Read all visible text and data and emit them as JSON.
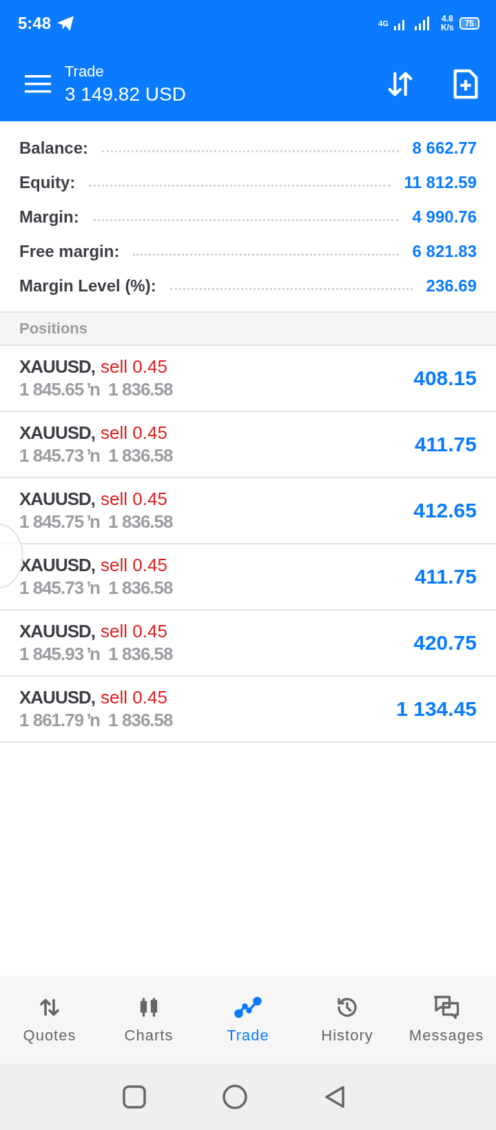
{
  "status_bar": {
    "time": "5:48",
    "network": "4G",
    "speed_value": "4.8",
    "speed_unit": "K/s",
    "battery": "75"
  },
  "header": {
    "title": "Trade",
    "subtitle": "3 149.82 USD"
  },
  "summary": [
    {
      "label": "Balance:",
      "value": "8 662.77"
    },
    {
      "label": "Equity:",
      "value": "11 812.59"
    },
    {
      "label": "Margin:",
      "value": "4 990.76"
    },
    {
      "label": "Free margin:",
      "value": "6 821.83"
    },
    {
      "label": "Margin Level (%):",
      "value": "236.69"
    }
  ],
  "positions_header": "Positions",
  "positions": [
    {
      "symbol": "XAUUSD,",
      "order": "sell 0.45",
      "prices": "1 845.65 ŉ  1 836.58",
      "profit": "408.15"
    },
    {
      "symbol": "XAUUSD,",
      "order": "sell 0.45",
      "prices": "1 845.73 ŉ  1 836.58",
      "profit": "411.75"
    },
    {
      "symbol": "XAUUSD,",
      "order": "sell 0.45",
      "prices": "1 845.75 ŉ  1 836.58",
      "profit": "412.65"
    },
    {
      "symbol": "XAUUSD,",
      "order": "sell 0.45",
      "prices": "1 845.73 ŉ  1 836.58",
      "profit": "411.75"
    },
    {
      "symbol": "XAUUSD,",
      "order": "sell 0.45",
      "prices": "1 845.93 ŉ  1 836.58",
      "profit": "420.75"
    },
    {
      "symbol": "XAUUSD,",
      "order": "sell 0.45",
      "prices": "1 861.79 ŉ  1 836.58",
      "profit": "1 134.45"
    }
  ],
  "tabs": [
    {
      "label": "Quotes",
      "kind": "quotes",
      "selected": false
    },
    {
      "label": "Charts",
      "kind": "charts",
      "selected": false
    },
    {
      "label": "Trade",
      "kind": "trade",
      "selected": true
    },
    {
      "label": "History",
      "kind": "history",
      "selected": false
    },
    {
      "label": "Messages",
      "kind": "messages",
      "selected": false
    }
  ]
}
